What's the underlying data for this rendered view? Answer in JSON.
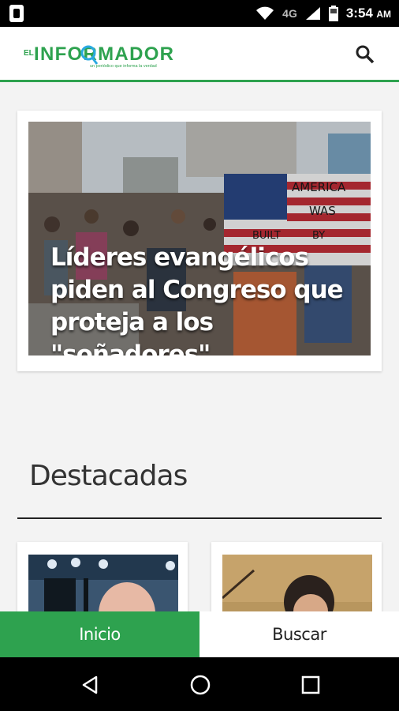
{
  "status_bar": {
    "time": "3:54",
    "ampm": "AM",
    "network": "4G"
  },
  "header": {
    "logo_el": "EL",
    "logo_name": "INFORMADOR",
    "logo_tagline": "un periódico que informa la verdad",
    "brand_color": "#2ea24f",
    "search_icon": "search-icon"
  },
  "hero": {
    "title": "Líderes evangélicos piden al Congreso que proteja a los \"soñadores\"",
    "sign_text": [
      "AMERICA",
      "WAS",
      "BUILT",
      "BY"
    ]
  },
  "section": {
    "title": "Destacadas"
  },
  "bottom_nav": {
    "home_label": "Inicio",
    "search_label": "Buscar"
  }
}
